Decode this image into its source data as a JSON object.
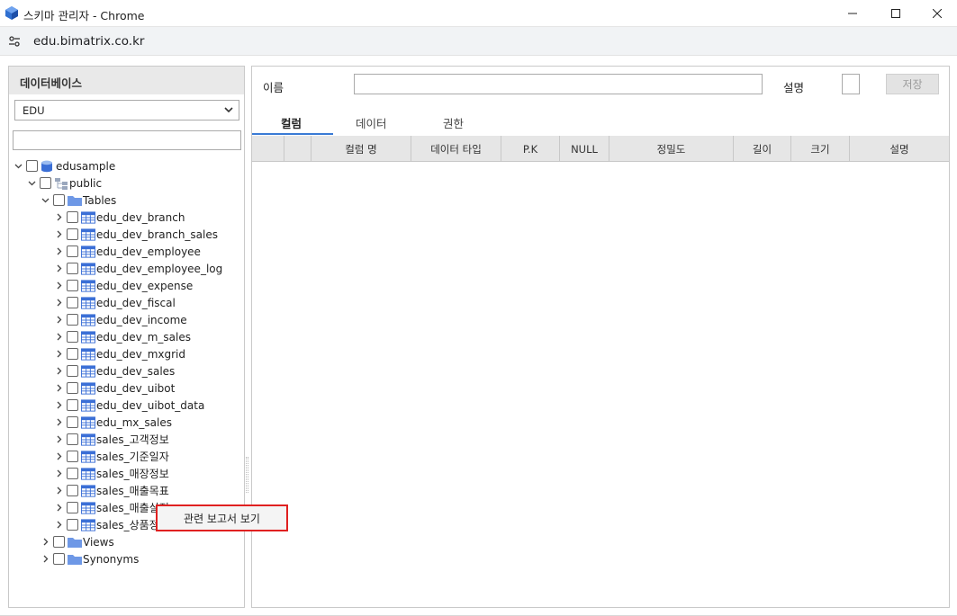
{
  "window": {
    "title": "스키마 관리자 - Chrome"
  },
  "address": {
    "url": "edu.bimatrix.co.kr"
  },
  "left_panel": {
    "header": "데이터베이스",
    "db_select": "EDU",
    "search_value": "",
    "tree": {
      "root": "edusample",
      "schema": "public",
      "tables_folder": "Tables",
      "tables": [
        "edu_dev_branch",
        "edu_dev_branch_sales",
        "edu_dev_employee",
        "edu_dev_employee_log",
        "edu_dev_expense",
        "edu_dev_fiscal",
        "edu_dev_income",
        "edu_dev_m_sales",
        "edu_dev_mxgrid",
        "edu_dev_sales",
        "edu_dev_uibot",
        "edu_dev_uibot_data",
        "edu_mx_sales",
        "sales_고객정보",
        "sales_기준일자",
        "sales_매장정보",
        "sales_매출목표",
        "sales_매출실적",
        "sales_상품정보"
      ],
      "views_folder": "Views",
      "synonyms_folder": "Synonyms"
    }
  },
  "context_menu": {
    "item": "관련 보고서 보기"
  },
  "right_panel": {
    "name_label": "이름",
    "name_value": "",
    "desc_label": "설명",
    "save_button": "저장",
    "tabs": [
      "컬럼",
      "데이터",
      "권한"
    ],
    "active_tab": 0,
    "columns": [
      "",
      "",
      "컬럼 명",
      "데이터 타입",
      "P.K",
      "NULL",
      "정밀도",
      "길이",
      "크기",
      "설명"
    ]
  },
  "colors": {
    "accent": "#3a7bd5",
    "context_border": "#e02020",
    "table_icon": "#3b6fd6"
  }
}
